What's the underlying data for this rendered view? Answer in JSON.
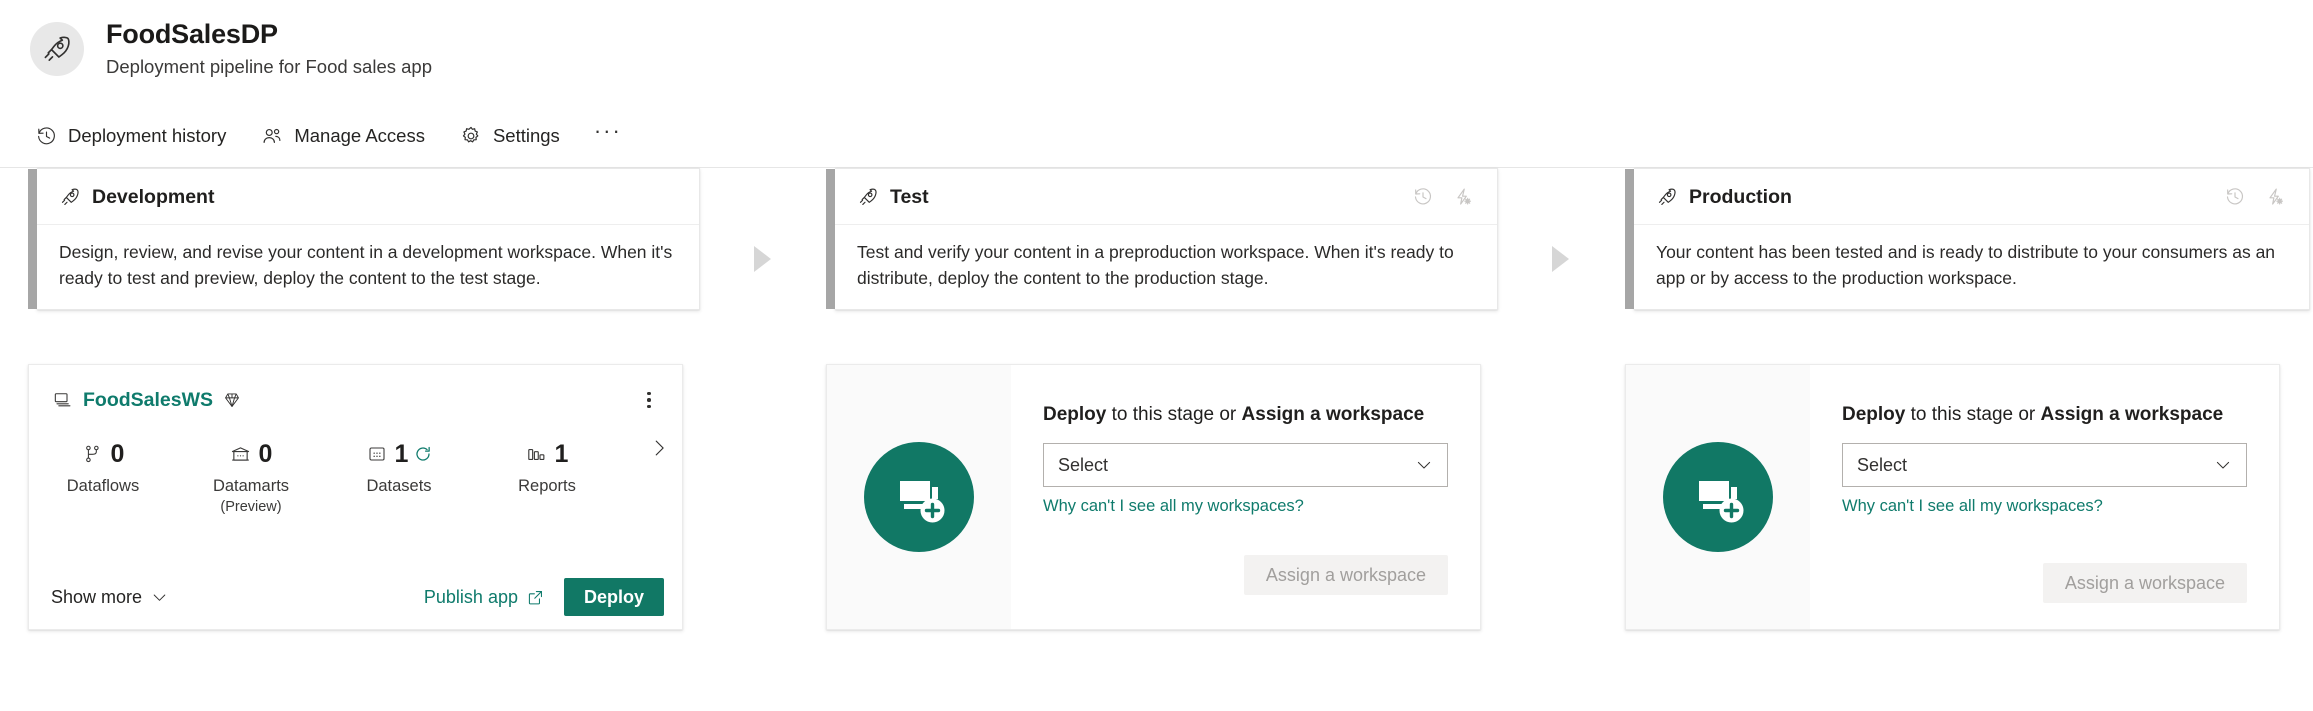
{
  "header": {
    "avatar_icon": "rocket-icon",
    "title": "FoodSalesDP",
    "subtitle": "Deployment pipeline for Food sales app",
    "toolbar": [
      {
        "id": "deployment-history",
        "label": "Deployment history",
        "icon": "history-icon"
      },
      {
        "id": "manage-access",
        "label": "Manage Access",
        "icon": "people-icon"
      },
      {
        "id": "settings",
        "label": "Settings",
        "icon": "gear-icon"
      }
    ],
    "overflow_label": "···"
  },
  "stages": [
    {
      "id": "development",
      "name": "Development",
      "icon": "rocket-icon",
      "description": "Design, review, and revise your content in a development workspace. When it's ready to test and preview, deploy the content to the test stage.",
      "actions": []
    },
    {
      "id": "test",
      "name": "Test",
      "icon": "rocket-icon",
      "description": "Test and verify your content in a preproduction workspace. When it's ready to distribute, deploy the content to the production stage.",
      "actions": [
        {
          "id": "deployment-history",
          "icon": "history-icon"
        },
        {
          "id": "deployment-rules",
          "icon": "lightning-gear-icon"
        }
      ]
    },
    {
      "id": "production",
      "name": "Production",
      "icon": "rocket-icon",
      "description": "Your content has been tested and is ready to distribute to your consumers as an app or by access to the production workspace.",
      "actions": [
        {
          "id": "deployment-history",
          "icon": "history-icon"
        },
        {
          "id": "deployment-rules",
          "icon": "lightning-gear-icon"
        }
      ]
    }
  ],
  "workspace_card": {
    "icon": "workspace-icon",
    "name": "FoodSalesWS",
    "badge_icon": "premium-diamond-icon",
    "more_icon": "more-vertical-icon",
    "next_icon": "chevron-right-icon",
    "metrics": [
      {
        "id": "dataflows",
        "icon": "dataflow-icon",
        "value": "0",
        "label": "Dataflows",
        "sub": "",
        "refresh": false
      },
      {
        "id": "datamarts",
        "icon": "datamart-icon",
        "value": "0",
        "label": "Datamarts",
        "sub": "(Preview)",
        "refresh": false
      },
      {
        "id": "datasets",
        "icon": "dataset-icon",
        "value": "1",
        "label": "Datasets",
        "sub": "",
        "refresh": true
      },
      {
        "id": "reports",
        "icon": "report-icon",
        "value": "1",
        "label": "Reports",
        "sub": "",
        "refresh": false
      }
    ],
    "show_more_label": "Show more",
    "show_more_icon": "chevron-down-icon",
    "publish_app_label": "Publish app",
    "publish_app_icon": "external-link-icon",
    "deploy_label": "Deploy"
  },
  "empty_stage": {
    "illustration_icon": "add-workspace-icon",
    "title_prefix": "Deploy",
    "title_middle": " to this stage or ",
    "title_suffix": "Assign a workspace",
    "select_value": "Select",
    "select_chevron_icon": "chevron-down-icon",
    "help_link": "Why can't I see all my workspaces?",
    "assign_label": "Assign a workspace"
  },
  "colors": {
    "brand_teal": "#117865",
    "link_teal": "#0f7b6c",
    "stage_accent": "#a6a6a6",
    "arrow": "#d6d6d6",
    "disabled_button_bg": "#f3f2f1",
    "disabled_button_text": "#a19f9d"
  }
}
